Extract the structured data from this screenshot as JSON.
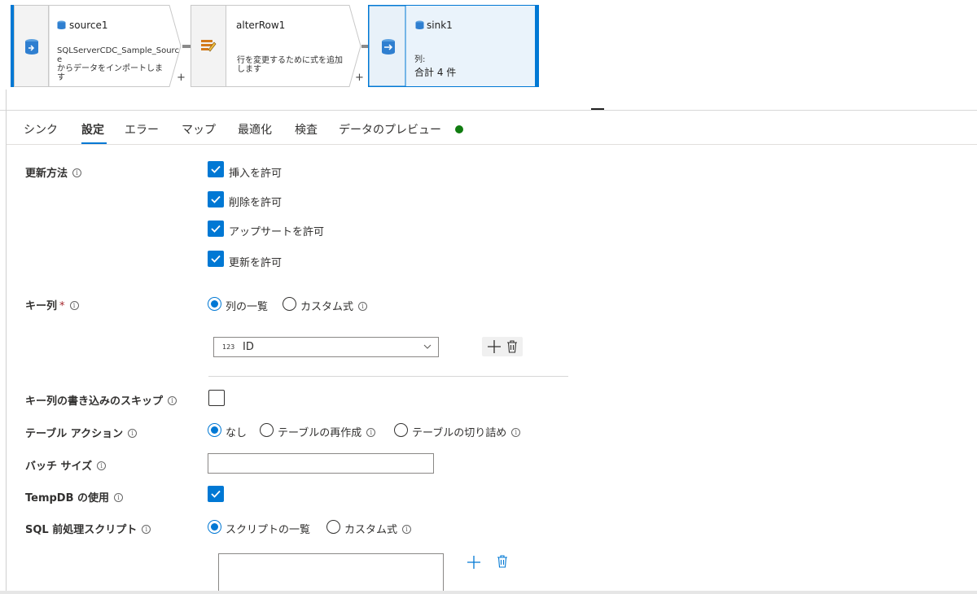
{
  "pipeline": {
    "nodes": [
      {
        "name": "source1",
        "description_lines": [
          "SQLServerCDC_Sample_Sourc",
          "e",
          "からデータをインポートしま",
          "す"
        ],
        "icon": "sql-source-icon"
      },
      {
        "name": "alterRow1",
        "description_lines": [
          "行を変更するために式を追加",
          "します"
        ],
        "icon": "alter-row-icon"
      },
      {
        "name": "sink1",
        "columns_label": "列:",
        "columns_value": "合計 4 件",
        "icon": "sql-sink-icon"
      }
    ],
    "plus": "+"
  },
  "tabs": [
    {
      "label": "シンク"
    },
    {
      "label": "設定",
      "active": true
    },
    {
      "label": "エラー"
    },
    {
      "label": "マップ"
    },
    {
      "label": "最適化"
    },
    {
      "label": "検査"
    },
    {
      "label": "データのプレビュー",
      "status_color": "#107c10"
    }
  ],
  "settings": {
    "update_method": {
      "label": "更新方法",
      "options": [
        {
          "label": "挿入を許可",
          "checked": true
        },
        {
          "label": "削除を許可",
          "checked": true
        },
        {
          "label": "アップサートを許可",
          "checked": true
        },
        {
          "label": "更新を許可",
          "checked": true
        }
      ]
    },
    "key_columns": {
      "label": "キー列",
      "required_mark": "*",
      "radio_list": "列の一覧",
      "radio_custom": "カスタム式",
      "selected": "列の一覧",
      "column_type": "123",
      "column_value": "ID"
    },
    "skip_key_write": {
      "label": "キー列の書き込みのスキップ",
      "checked": false
    },
    "table_action": {
      "label": "テーブル アクション",
      "options": [
        "なし",
        "テーブルの再作成",
        "テーブルの切り詰め"
      ],
      "selected": "なし"
    },
    "batch_size": {
      "label": "バッチ サイズ",
      "value": ""
    },
    "use_tempdb": {
      "label": "TempDB の使用",
      "checked": true
    },
    "pre_sql": {
      "label": "SQL 前処理スクリプト",
      "radio_list": "スクリプトの一覧",
      "radio_custom": "カスタム式",
      "selected": "スクリプトの一覧",
      "value": ""
    }
  },
  "colors": {
    "accent": "#0078d4",
    "selected_node_bg": "#eaf3fb",
    "success": "#107c10"
  }
}
